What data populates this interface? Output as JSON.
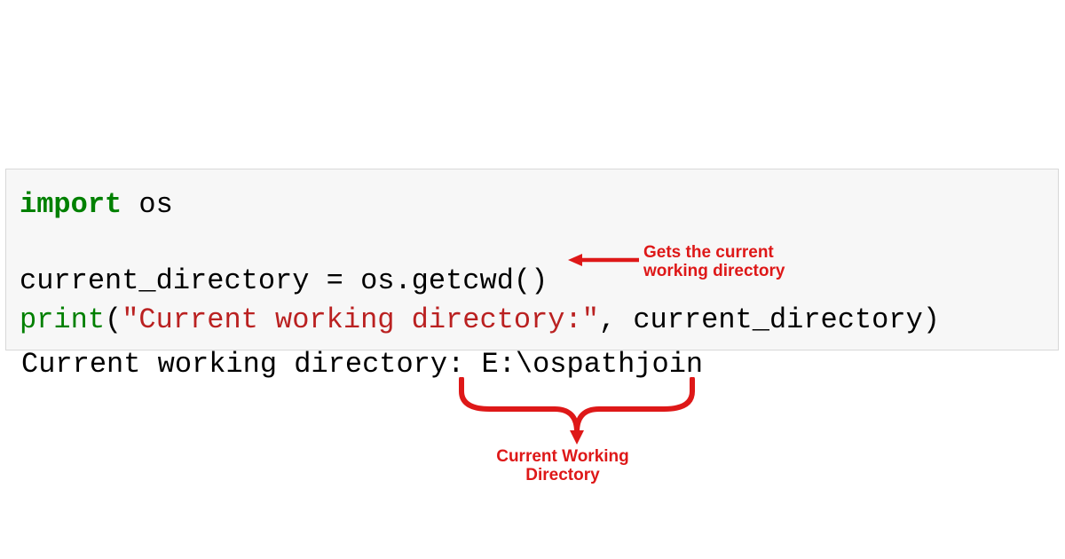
{
  "code": {
    "line1_kw": "import",
    "line1_mod": " os",
    "line2_var": "current_directory = os.getcwd()",
    "line3_fn": "print",
    "line3_open": "(",
    "line3_str": "\"Current working directory:\"",
    "line3_rest": ", current_directory)"
  },
  "output": {
    "text": "Current working directory: E:\\ospathjoin"
  },
  "annotations": {
    "getcwd_label_line1": "Gets the current",
    "getcwd_label_line2": "working directory",
    "cwd_brace_line1": "Current Working",
    "cwd_brace_line2": "Directory"
  },
  "colors": {
    "annotation_red": "#de1818",
    "keyword_green": "#008000",
    "string_red": "#ba2121"
  }
}
